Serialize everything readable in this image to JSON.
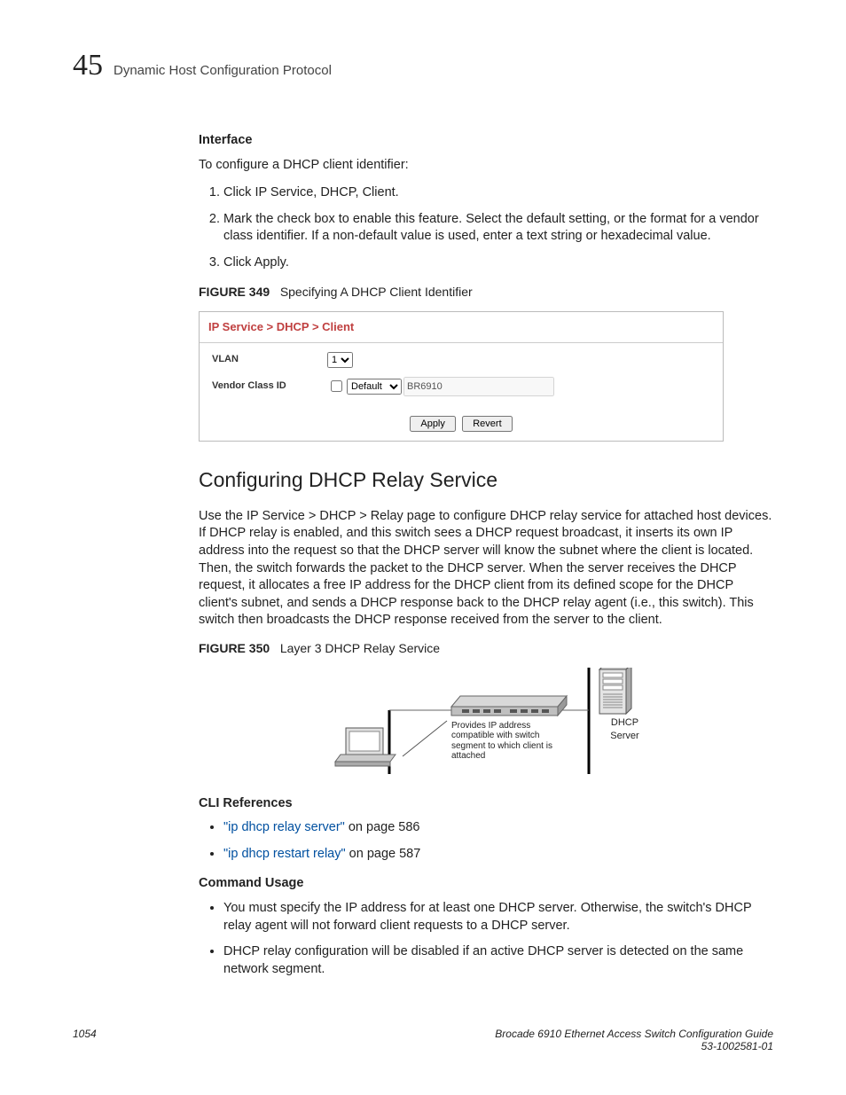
{
  "header": {
    "chapter_number": "45",
    "chapter_title": "Dynamic Host Configuration Protocol"
  },
  "interface": {
    "heading": "Interface",
    "intro": "To configure a DHCP client identifier:",
    "steps": [
      "Click IP Service, DHCP, Client.",
      "Mark the check box to enable this feature. Select the default setting, or the format for a vendor class identifier. If a non-default value is used, enter a text string or hexadecimal value.",
      "Click Apply."
    ]
  },
  "figure349": {
    "caption_num": "FIGURE 349",
    "caption_title": "Specifying A DHCP Client Identifier",
    "breadcrumb": "IP Service > DHCP > Client",
    "vlan_label": "VLAN",
    "vlan_value": "1",
    "vendor_label": "Vendor Class ID",
    "vendor_mode": "Default",
    "vendor_value": "BR6910",
    "apply": "Apply",
    "revert": "Revert"
  },
  "section2": {
    "title": "Configuring DHCP Relay Service",
    "body": "Use the IP Service > DHCP > Relay page to configure DHCP relay service for attached host devices. If DHCP relay is enabled, and this switch sees a DHCP request broadcast, it inserts its own IP address into the request so that the DHCP server will know the subnet where the client is located. Then, the switch forwards the packet to the DHCP server. When the server receives the DHCP request, it allocates a free IP address for the DHCP client from its defined scope for the DHCP client's subnet, and sends a DHCP response back to the DHCP relay agent (i.e., this switch). This switch then broadcasts the DHCP response received from the server to the client."
  },
  "figure350": {
    "caption_num": "FIGURE 350",
    "caption_title": "Layer 3 DHCP Relay Service",
    "note": "Provides IP address compatible with switch segment to which client is attached",
    "server_label": "DHCP Server"
  },
  "cli": {
    "heading": "CLI References",
    "items": [
      {
        "link": "\"ip dhcp relay server\"",
        "rest": " on page 586"
      },
      {
        "link": "\"ip dhcp restart relay\"",
        "rest": " on page 587"
      }
    ]
  },
  "usage": {
    "heading": "Command Usage",
    "items": [
      "You must specify the IP address for at least one DHCP server. Otherwise, the switch's DHCP relay agent will not forward client requests to a DHCP server.",
      "DHCP relay configuration will be disabled if an active DHCP server is detected on the same network segment."
    ]
  },
  "footer": {
    "page": "1054",
    "doc_title": "Brocade 6910 Ethernet Access Switch Configuration Guide",
    "doc_num": "53-1002581-01"
  }
}
